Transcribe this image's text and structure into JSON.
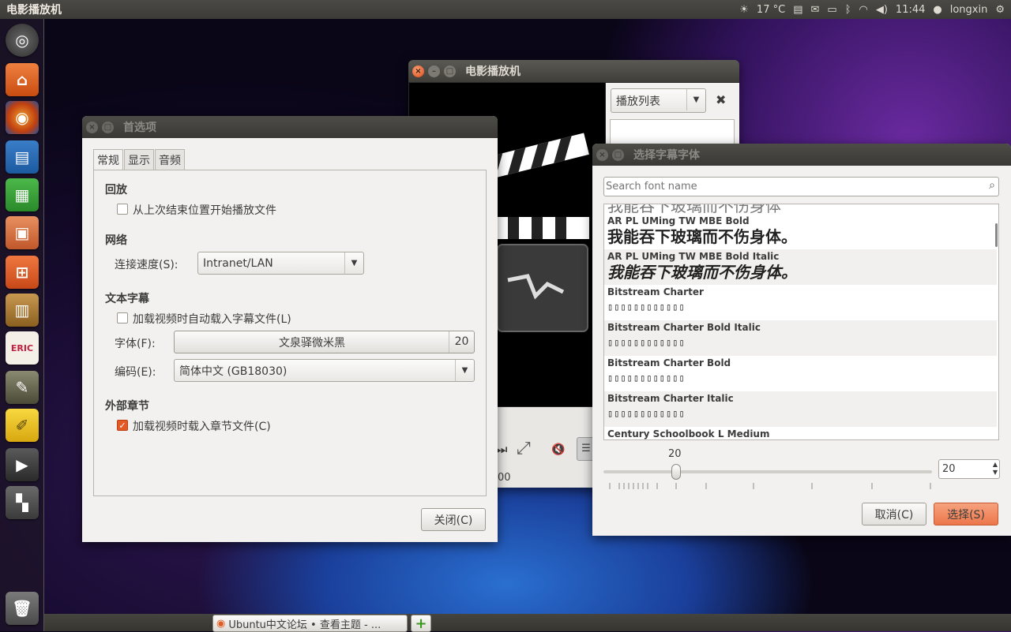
{
  "topbar": {
    "app_title": "电影播放机",
    "weather": "17 °C",
    "time": "11:44",
    "user": "longxin"
  },
  "launcher": {
    "items": [
      "dash",
      "files",
      "firefox",
      "writer",
      "calc",
      "impress",
      "software-center",
      "ebook",
      "eric",
      "gimp",
      "text-editor",
      "movie-player",
      "workspaces",
      "trash"
    ]
  },
  "player": {
    "title": "电影播放机",
    "playlist_select": "播放列表",
    "time_fragment": "00"
  },
  "prefs": {
    "title": "首选项",
    "tabs": [
      "常规",
      "显示",
      "音频"
    ],
    "playback_header": "回放",
    "resume_label": "从上次结束位置开始播放文件",
    "network_header": "网络",
    "speed_label": "连接速度(S):",
    "speed_value": "Intranet/LAN",
    "subtitle_header": "文本字幕",
    "autoload_label": "加载视频时自动载入字幕文件(L)",
    "font_label": "字体(F):",
    "font_value": "文泉驿微米黑",
    "font_size": "20",
    "encoding_label": "编码(E):",
    "encoding_value": "简体中文 (GB18030)",
    "chapters_header": "外部章节",
    "chapters_label": "加载视频时载入章节文件(C)",
    "close_button": "关闭(C)"
  },
  "fontdlg": {
    "title": "选择字幕字体",
    "search_placeholder": "Search font name",
    "cut_sample": "我能吞下玻璃而不伤身体",
    "fonts": [
      {
        "name": "AR PL UMing TW MBE Bold",
        "sample": "我能吞下玻璃而不伤身体。"
      },
      {
        "name": "AR PL UMing TW MBE Bold Italic",
        "sample": "我能吞下玻璃而不伤身体。"
      },
      {
        "name": "Bitstream Charter",
        "sample": "▯▯▯▯▯▯▯▯▯▯▯▯"
      },
      {
        "name": "Bitstream Charter Bold Italic",
        "sample": "▯▯▯▯▯▯▯▯▯▯▯▯"
      },
      {
        "name": "Bitstream Charter Bold",
        "sample": "▯▯▯▯▯▯▯▯▯▯▯▯"
      },
      {
        "name": "Bitstream Charter Italic",
        "sample": "▯▯▯▯▯▯▯▯▯▯▯▯"
      },
      {
        "name": "Century Schoolbook L Medium",
        "sample": ""
      }
    ],
    "size_value": "20",
    "size_slider_fraction": 0.2,
    "cancel_button": "取消(C)",
    "select_button": "选择(S)"
  },
  "taskbar": {
    "browser_tab": "Ubuntu中文论坛 • 查看主题 - ..."
  }
}
